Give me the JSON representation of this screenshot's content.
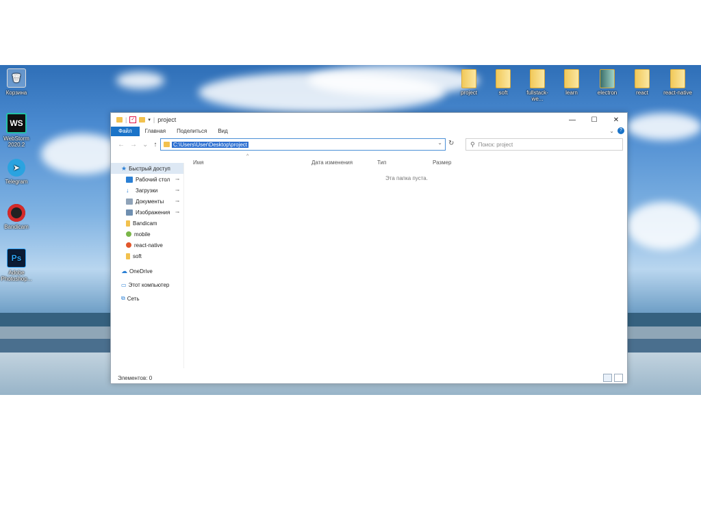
{
  "desktop": {
    "left_icons": [
      {
        "label": "Корзина",
        "icon": "recycle-bin-icon"
      },
      {
        "label": "WebStorm 2020.2",
        "icon": "webstorm-icon",
        "glyph": "WS"
      },
      {
        "label": "Telegram",
        "icon": "telegram-icon"
      },
      {
        "label": "Bandicam",
        "icon": "bandicam-icon"
      },
      {
        "label": "Adobe Photoshop...",
        "icon": "photoshop-icon",
        "glyph": "Ps"
      }
    ],
    "top_icons": [
      {
        "label": "project"
      },
      {
        "label": "soft"
      },
      {
        "label": "fullstack-we..."
      },
      {
        "label": "learn"
      },
      {
        "label": "electron"
      },
      {
        "label": "react"
      },
      {
        "label": "react-native"
      }
    ]
  },
  "explorer": {
    "title": "project",
    "controls": {
      "minimize": "—",
      "maximize": "☐",
      "close": "✕"
    },
    "ribbon": {
      "file": "Файл",
      "home": "Главная",
      "share": "Поделиться",
      "view": "Вид",
      "help": "?"
    },
    "nav": {
      "back": "←",
      "forward": "→",
      "recent": "⌄",
      "up": "↑"
    },
    "address": "C:\\Users\\User\\Desktop\\project",
    "refresh": "↻",
    "search_placeholder": "Поиск: project",
    "sidebar": {
      "quick_access": "Быстрый доступ",
      "items": [
        {
          "label": "Рабочий стол",
          "pinned": true,
          "color": "#2a7fd4"
        },
        {
          "label": "Загрузки",
          "pinned": true,
          "color": "#2a7fd4"
        },
        {
          "label": "Документы",
          "pinned": true,
          "color": "#8fa3b8"
        },
        {
          "label": "Изображения",
          "pinned": true,
          "color": "#6f8fb0"
        },
        {
          "label": "Bandicam",
          "pinned": false,
          "color": "#f2c14e"
        },
        {
          "label": "mobile",
          "pinned": false,
          "color": "#7ab648"
        },
        {
          "label": "react-native",
          "pinned": false,
          "color": "#e2572c"
        },
        {
          "label": "soft",
          "pinned": false,
          "color": "#f2c14e"
        }
      ],
      "onedrive": "OneDrive",
      "this_pc": "Этот компьютер",
      "network": "Сеть"
    },
    "columns": [
      "Имя",
      "Дата изменения",
      "Тип",
      "Размер"
    ],
    "empty_message": "Эта папка пуста.",
    "status": "Элементов: 0",
    "pin_glyph": "📌"
  }
}
